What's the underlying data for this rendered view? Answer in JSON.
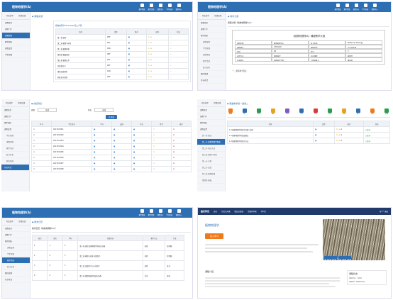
{
  "app_title": "植物地理学(A)",
  "header_icons": [
    {
      "label": "教学看板",
      "icon": "board-icon"
    },
    {
      "label": "教学资源",
      "icon": "resource-icon"
    },
    {
      "label": "课程评价",
      "icon": "evaluate-icon"
    },
    {
      "label": "学习分析",
      "icon": "chart-icon"
    },
    {
      "label": "课程中心",
      "icon": "send-icon"
    }
  ],
  "sidebar": {
    "tab_nav": "导航菜单",
    "tab_course": "授课班课",
    "items": [
      "课程首页",
      "课程门户",
      "教学团队",
      "课程设置",
      "学生管理",
      "课程资源",
      "教学活动",
      "统计分析",
      "题库管理",
      "作业考试"
    ]
  },
  "p1": {
    "crumb": "◆ 课程资源",
    "semester": "植物地理学2019-2020第二学期",
    "columns": [
      "名称",
      "类型",
      "大小",
      "预览",
      "操作",
      "状态"
    ],
    "rows": [
      {
        "name": "第一章 绪论",
        "type": "PDF"
      },
      {
        "name": "第二章 植物与环境",
        "type": "PPT"
      },
      {
        "name": "第三章 植物群落",
        "type": "DOC"
      },
      {
        "name": "第四章 植被类型",
        "type": "PDF"
      },
      {
        "name": "第五章 植物区系",
        "type": "PPT"
      },
      {
        "name": "实验指导书",
        "type": "PDF"
      },
      {
        "name": "课外阅读资料",
        "type": "DOC"
      },
      {
        "name": "期末复习提纲",
        "type": "PDF"
      }
    ]
  },
  "p2": {
    "crumb": "◆ 教学大纲",
    "subtitle": "课程大纲《植物地理学(A)》",
    "doc_title": "《植物地理学A》课程教学大纲",
    "fields": [
      [
        "课程名称",
        "植物地理学A",
        "英文名称",
        "Botanical Geology"
      ],
      [
        "课程编号",
        "0712109",
        "课程性质",
        "专业必修课"
      ],
      [
        "学时",
        "48",
        "学分",
        "3"
      ],
      [
        "适用专业",
        "地理科学",
        "先修课程",
        "植物学"
      ],
      [
        "开课单位",
        "地理科学学院",
        "大纲执笔人",
        "教研室"
      ]
    ],
    "footer": "一、课程教学目标"
  },
  "p3": {
    "crumb": "◆ 成绩列表",
    "filters": [
      "班级",
      "全部",
      "状态",
      "全部"
    ],
    "search": "Q 查询",
    "columns": [
      "序号",
      "学生姓名",
      "学号",
      "成绩",
      "作业",
      "考试",
      "评分",
      "操作"
    ],
    "rows": [
      "2017213001",
      "2017213002",
      "2017213003",
      "2017213004",
      "2017213005",
      "2017213006",
      "2017213007",
      "2017213008"
    ]
  },
  "p4": {
    "crumb": "◆ 课堂教学第一章第二",
    "toolbar": [
      "备课",
      "导入",
      "推送",
      "课件",
      "测试",
      "讨论",
      "作业",
      "问卷",
      "签到",
      "统计",
      "评价",
      "资源"
    ],
    "columns": [
      "名称",
      "类型",
      "操作",
      "状态"
    ],
    "rows": [
      {
        "name": "1.2 植物地理学的研究对象与任务",
        "status": "已发布"
      },
      {
        "name": "1.3 植物地理学的发展简史",
        "status": "已发布"
      },
      {
        "name": "1.4 植物地理学的研究方法",
        "status": "已发布"
      }
    ],
    "tree": [
      "第一章 绪论",
      "第一节 植物地理学概述",
      "第二节 研究方法",
      "第二章 植物与环境",
      "第一节 光照",
      "第二节 温度",
      "第三章 植物群落",
      "第四章 植被"
    ]
  },
  "p5": {
    "crumb": "◆ 教学日历",
    "subtitle": "教学日历《植物地理学(A)》",
    "columns": [
      "周次",
      "课次",
      "学时",
      "授课内容",
      "教学方法",
      "作业"
    ],
    "rows": [
      {
        "week": "1",
        "no": "1",
        "hours": "3",
        "content": "第一章 绪论 植物地理学的研究对象",
        "method": "讲授",
        "hw": "思考题"
      },
      {
        "week": "2",
        "no": "2",
        "hours": "3",
        "content": "第二章 植物与环境 光照因子",
        "method": "讲授",
        "hw": "思考题"
      },
      {
        "week": "3",
        "no": "3",
        "hours": "3",
        "content": "第二章 温度因子与水分因子",
        "method": "讲授",
        "hw": "练习"
      },
      {
        "week": "4",
        "no": "4",
        "hours": "3",
        "content": "第三章 植物群落的组成与结构",
        "method": "讨论",
        "hw": "报告"
      }
    ]
  },
  "p6": {
    "brand": "重庆师范",
    "nav": [
      "首页",
      "示范公开课",
      "精品在线课",
      "资源共享课",
      "学科门"
    ],
    "user": "张*** 退出",
    "course_title": "植物地理学",
    "join_btn": "加入学习",
    "section": "课程介绍",
    "team": "课程负责",
    "team_lines": [
      "课程负责人：张某某",
      "所属院系：地理科学学院"
    ]
  }
}
